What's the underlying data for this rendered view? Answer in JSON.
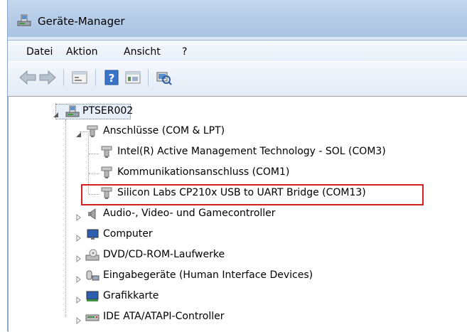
{
  "window": {
    "title": "Geräte-Manager"
  },
  "menu": {
    "items": [
      "Datei",
      "Aktion",
      "Ansicht",
      "?"
    ]
  },
  "toolbar": {
    "buttons": [
      "back-icon",
      "forward-icon",
      "properties-icon",
      "help-icon",
      "view-icon",
      "scan-hardware-icon"
    ]
  },
  "tree": {
    "root": {
      "label": "PTSER002",
      "expanded": true
    },
    "ports": {
      "label": "Anschlüsse (COM & LPT)",
      "expanded": true,
      "children": [
        "Intel(R) Active Management Technology - SOL (COM3)",
        "Kommunikationsanschluss (COM1)",
        "Silicon Labs CP210x USB to UART Bridge (COM13)"
      ],
      "highlighted_index": 2
    },
    "categories": [
      "Audio-, Video- und Gamecontroller",
      "Computer",
      "DVD/CD-ROM-Laufwerke",
      "Eingabegeräte (Human Interface Devices)",
      "Grafikkarte",
      "IDE ATA/ATAPI-Controller"
    ]
  },
  "colors": {
    "highlight": "#d21f1f",
    "titlebar": "#b7cde8"
  }
}
